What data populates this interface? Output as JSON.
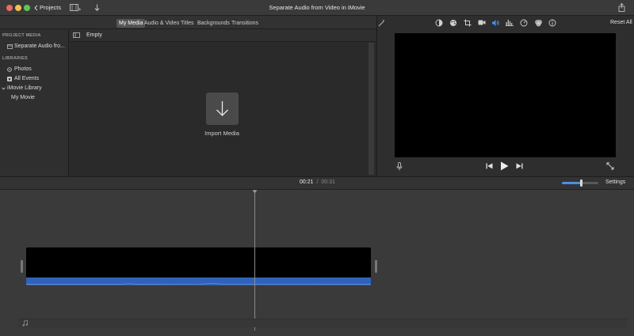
{
  "window": {
    "title": "Separate Audio from Video in iMovie"
  },
  "titlebar": {
    "back_label": "Projects"
  },
  "tabs": [
    {
      "label": "My Media",
      "active": true
    },
    {
      "label": "Audio & Video",
      "active": false
    },
    {
      "label": "Titles",
      "active": false
    },
    {
      "label": "Backgrounds",
      "active": false
    },
    {
      "label": "Transitions",
      "active": false
    }
  ],
  "viewer_toolbar": {
    "reset_label": "Reset All"
  },
  "sidebar": {
    "project_heading": "PROJECT MEDIA",
    "project_item": "Separate Audio fro...",
    "libraries_heading": "LIBRARIES",
    "items": [
      {
        "label": "Photos",
        "icon": "photos-icon"
      },
      {
        "label": "All Events",
        "icon": "star-icon"
      },
      {
        "label": "iMovie Library",
        "icon": "chevron-down-icon"
      },
      {
        "label": "My Movie",
        "icon": ""
      }
    ]
  },
  "browser": {
    "filter_label": "Empty",
    "import_label": "Import Media"
  },
  "timeline": {
    "current_time": "00:21",
    "separator": "/",
    "total_time": "00:31",
    "settings_label": "Settings",
    "zoom_level": 0.52
  },
  "colors": {
    "accent": "#2f62b8",
    "toolbar_active": "#4a8fe7"
  }
}
